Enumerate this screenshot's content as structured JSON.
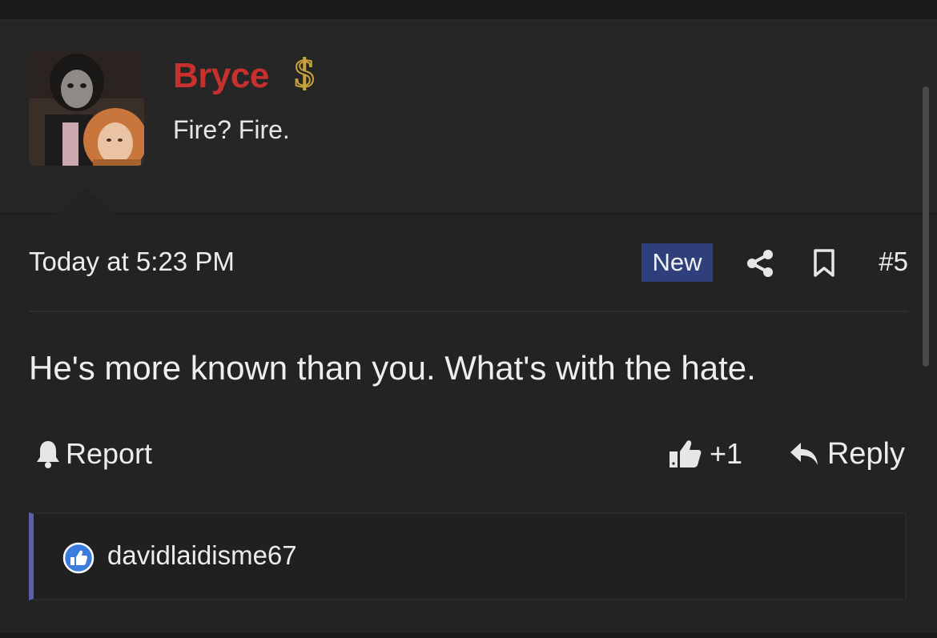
{
  "post": {
    "author": {
      "name": "Bryce",
      "title": "Fire? Fire.",
      "name_color": "#c8302e",
      "badge_icon": "dollar-sign-icon",
      "badge_color": "#c9a23a"
    },
    "meta": {
      "date": "Today at 5:23 PM",
      "new_badge": "New",
      "post_number": "#5"
    },
    "body": "He's more known than you. What's with the hate.",
    "actions": {
      "report": "Report",
      "like_count": "+1",
      "reply": "Reply"
    },
    "reactions": {
      "users": [
        "davidlaidisme67"
      ]
    }
  },
  "colors": {
    "accent_new_badge": "#2f3f7c",
    "reaction_bar_accent": "#5a5fa8",
    "like_reaction_icon": "#3b7ddd"
  }
}
